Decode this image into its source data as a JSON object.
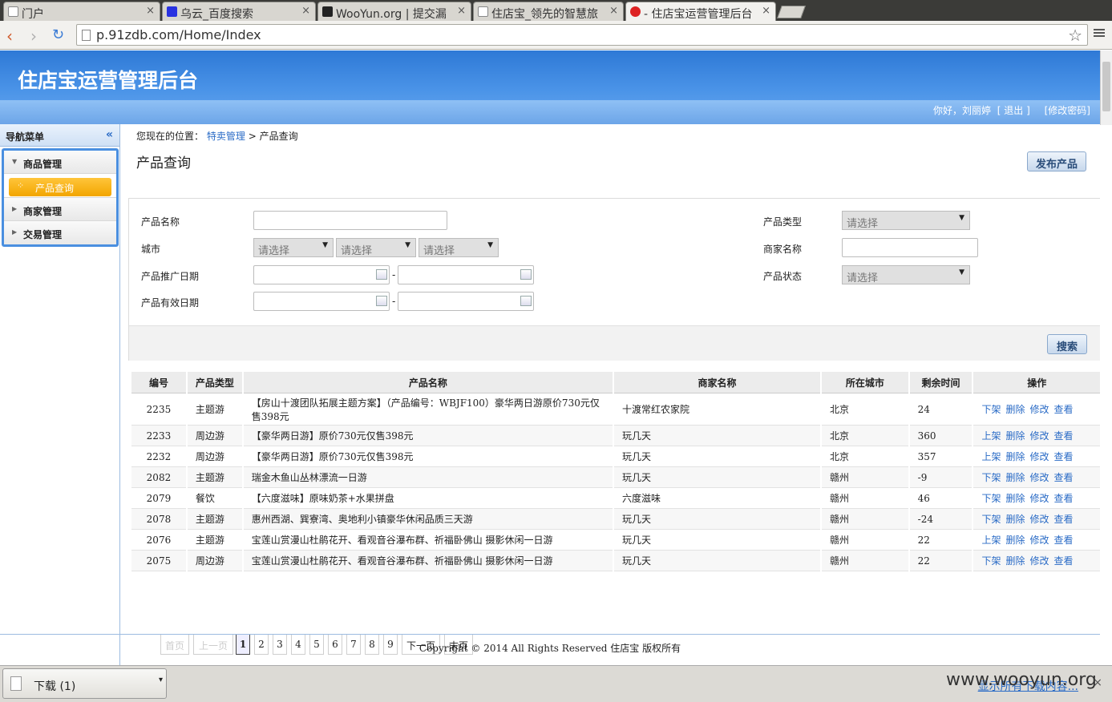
{
  "browser": {
    "tabs": [
      {
        "label": "门户",
        "active": false
      },
      {
        "label": "乌云_百度搜索",
        "active": false
      },
      {
        "label": "WooYun.org | 提交漏",
        "active": false
      },
      {
        "label": "住店宝_领先的智慧旅",
        "active": false
      },
      {
        "label": "- 住店宝运营管理后台",
        "active": true
      }
    ],
    "url": "p.91zdb.com/Home/Index",
    "close_glyph": "×"
  },
  "header": {
    "title": "住店宝运营管理后台",
    "greeting": "你好，刘丽婷",
    "logout": "[ 退出 ]",
    "change_password": "[修改密码]"
  },
  "sidebar": {
    "title": "导航菜单",
    "collapse_glyph": "«",
    "items": [
      {
        "label": "商品管理",
        "expanded": true,
        "children": [
          {
            "label": "产品查询",
            "active": true
          }
        ]
      },
      {
        "label": "商家管理",
        "expanded": false
      },
      {
        "label": "交易管理",
        "expanded": false
      }
    ]
  },
  "breadcrumb": {
    "prefix": "您现在的位置：",
    "link": "特卖管理",
    "sep": ">",
    "current": "产品查询"
  },
  "page_title": "产品查询",
  "publish_button": "发布产品",
  "filters": {
    "product_name_label": "产品名称",
    "city_label": "城市",
    "promo_date_label": "产品推广日期",
    "valid_date_label": "产品有效日期",
    "product_type_label": "产品类型",
    "merchant_name_label": "商家名称",
    "product_status_label": "产品状态",
    "select_placeholder": "请选择",
    "range_sep": "-",
    "search_button": "搜索"
  },
  "table": {
    "headers": [
      "编号",
      "产品类型",
      "产品名称",
      "商家名称",
      "所在城市",
      "剩余时间",
      "操作"
    ],
    "rows": [
      {
        "id": "2235",
        "type": "主题游",
        "name": "【房山十渡团队拓展主题方案】（产品编号：WBJF100）豪华两日游原价730元仅售398元",
        "merchant": "十渡常红农家院",
        "city": "北京",
        "remain": "24",
        "shelf": "下架"
      },
      {
        "id": "2233",
        "type": "周边游",
        "name": "【豪华两日游】原价730元仅售398元",
        "merchant": "玩几天",
        "city": "北京",
        "remain": "360",
        "shelf": "上架"
      },
      {
        "id": "2232",
        "type": "周边游",
        "name": "【豪华两日游】原价730元仅售398元",
        "merchant": "玩几天",
        "city": "北京",
        "remain": "357",
        "shelf": "上架"
      },
      {
        "id": "2082",
        "type": "主题游",
        "name": "瑞金木鱼山丛林漂流一日游",
        "merchant": "玩几天",
        "city": "赣州",
        "remain": "-9",
        "shelf": "下架"
      },
      {
        "id": "2079",
        "type": "餐饮",
        "name": "【六度滋味】原味奶茶+水果拼盘",
        "merchant": "六度滋味",
        "city": "赣州",
        "remain": "46",
        "shelf": "下架"
      },
      {
        "id": "2078",
        "type": "主题游",
        "name": "惠州西湖、巽寮湾、奥地利小镇豪华休闲品质三天游",
        "merchant": "玩几天",
        "city": "赣州",
        "remain": "-24",
        "shelf": "下架"
      },
      {
        "id": "2076",
        "type": "主题游",
        "name": "宝莲山赏漫山杜鹃花开、看观音谷瀑布群、祈福卧佛山 摄影休闲一日游",
        "merchant": "玩几天",
        "city": "赣州",
        "remain": "22",
        "shelf": "上架"
      },
      {
        "id": "2075",
        "type": "周边游",
        "name": "宝莲山赏漫山杜鹃花开、看观音谷瀑布群、祈福卧佛山 摄影休闲一日游",
        "merchant": "玩几天",
        "city": "赣州",
        "remain": "22",
        "shelf": "下架"
      }
    ],
    "ops": [
      "删除",
      "修改",
      "查看"
    ]
  },
  "pager": {
    "first": "首页",
    "prev": "上一页",
    "pages": [
      "1",
      "2",
      "3",
      "4",
      "5",
      "6",
      "7",
      "8",
      "9"
    ],
    "current": "1",
    "next": "下一页",
    "last": "末页"
  },
  "footer": "Copyright © 2014 All Rights Reserved 住店宝 版权所有",
  "downloads": {
    "item": "下载 (1)",
    "show_all": "显示所有下载内容...",
    "watermark": "www.wooyun.org"
  },
  "colors": {
    "accent": "#2e79d6",
    "link": "#2a6bc6",
    "active_menu": "#f2a500"
  }
}
